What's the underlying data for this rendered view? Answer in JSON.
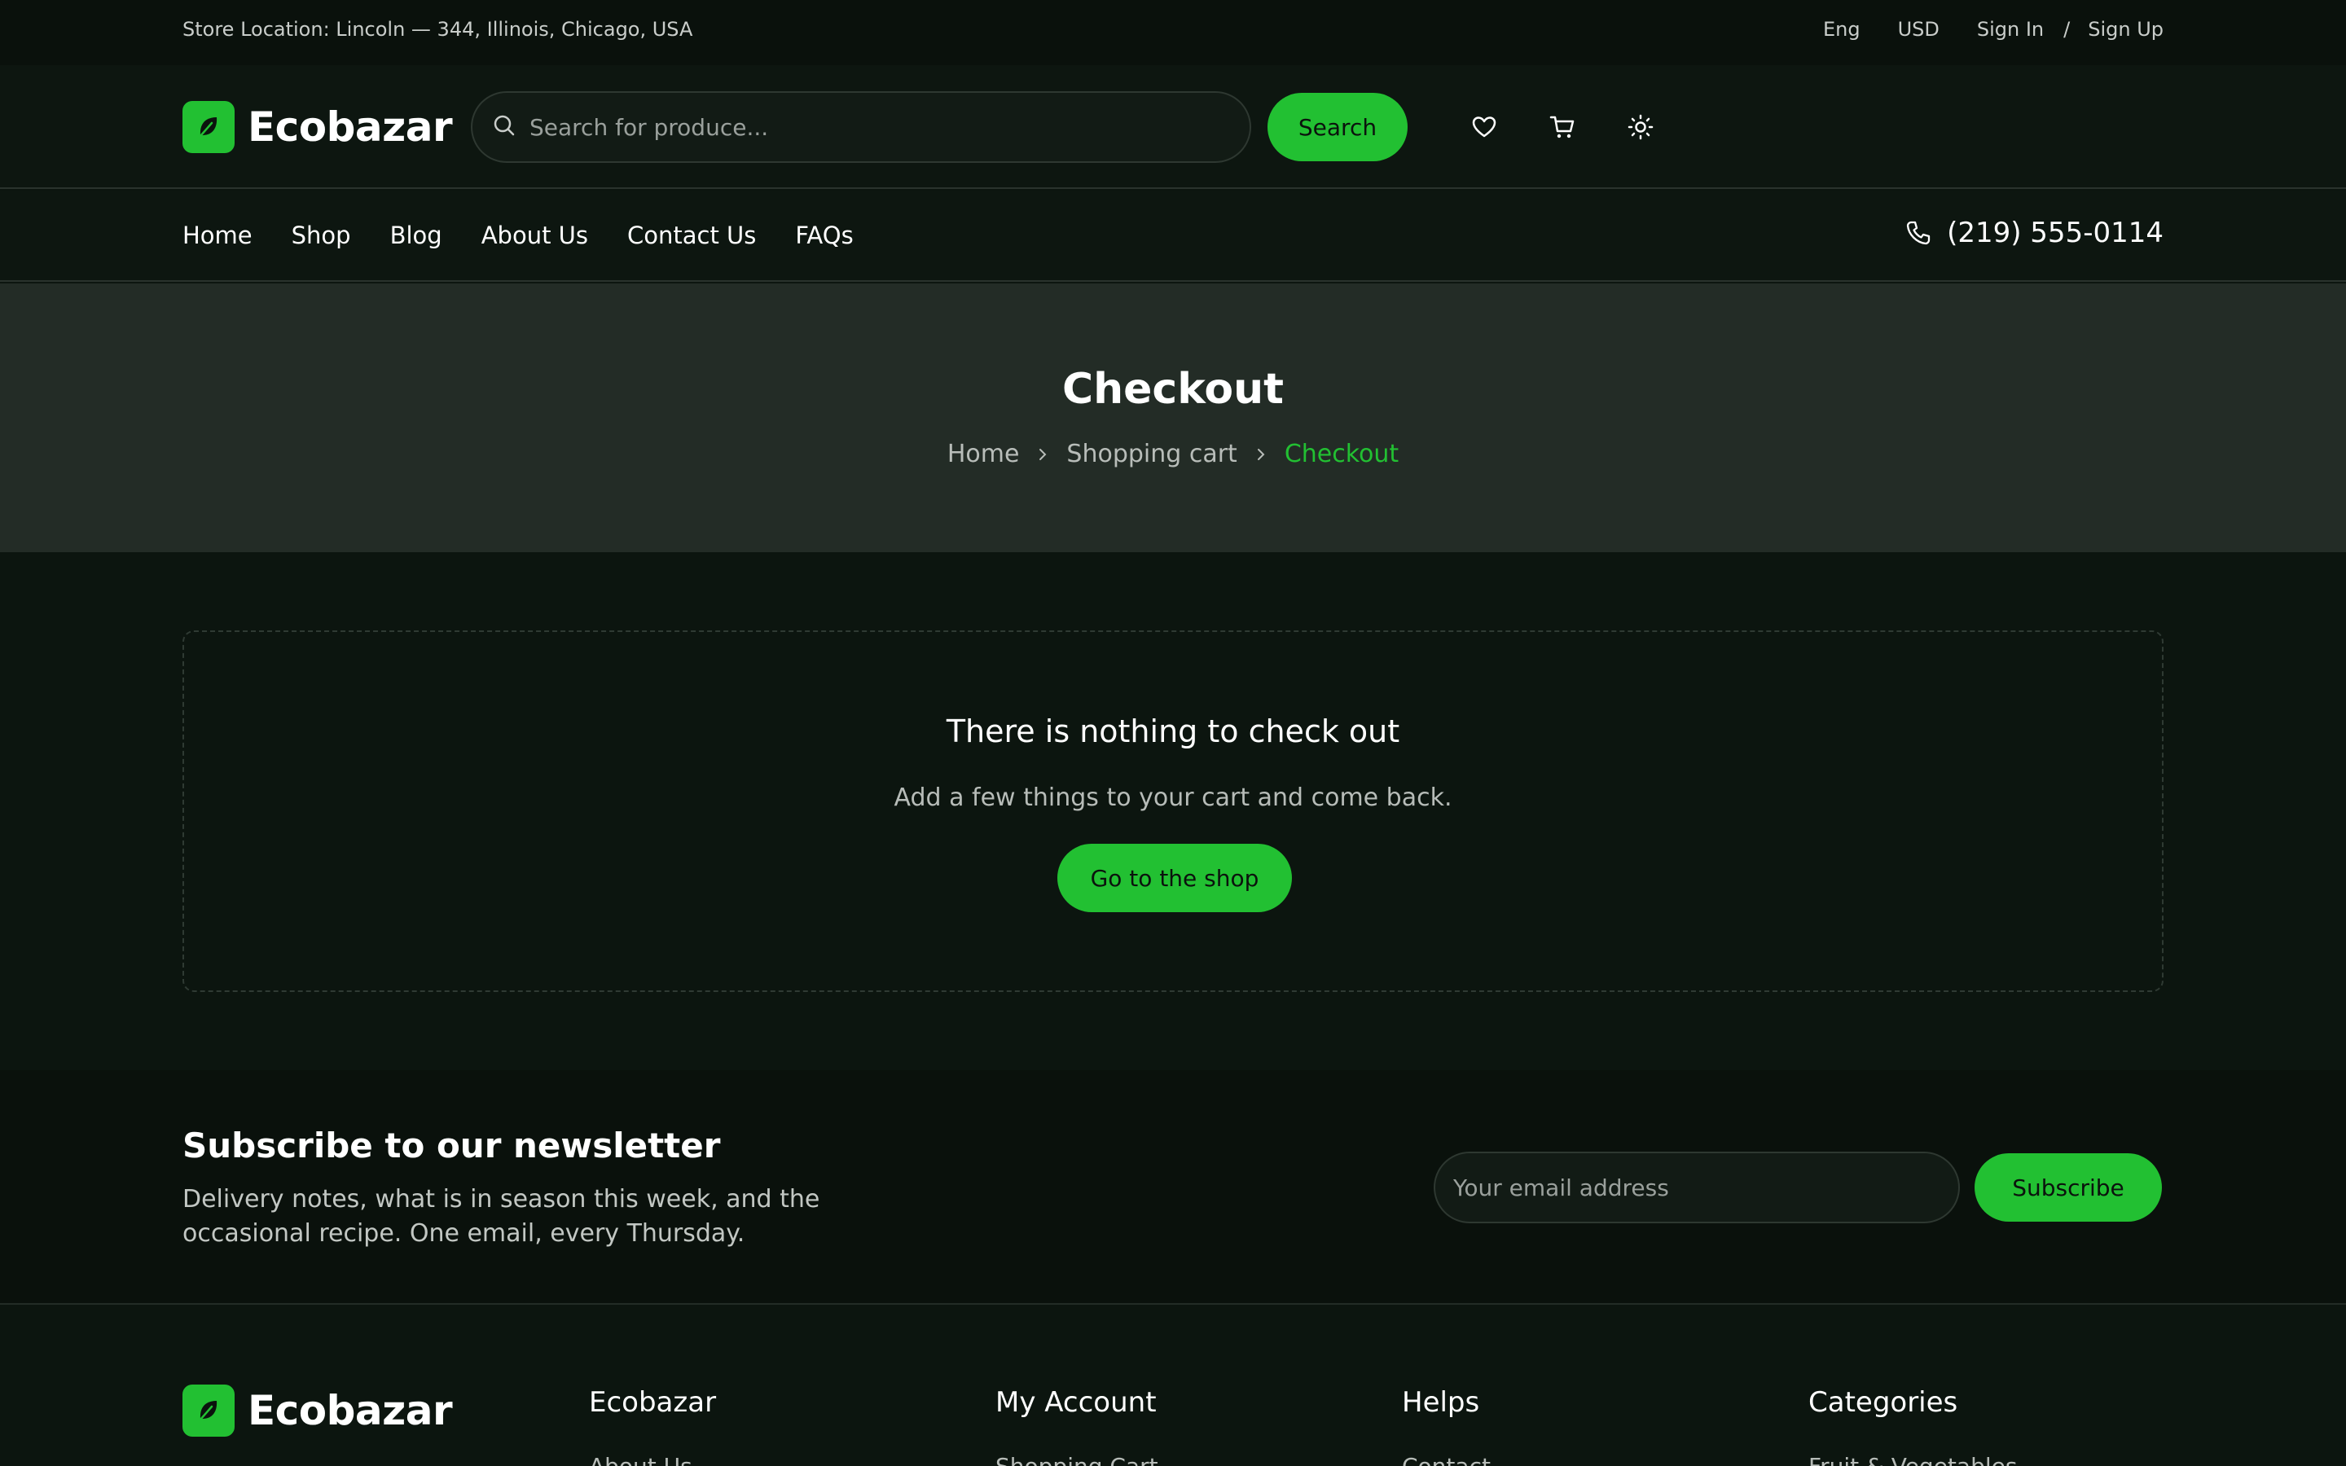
{
  "topbar": {
    "location": "Store Location: Lincoln — 344, Illinois, Chicago, USA",
    "language": "Eng",
    "currency": "USD",
    "sign_in": "Sign In",
    "separator": "/",
    "sign_up": "Sign Up"
  },
  "header": {
    "brand": "Ecobazar",
    "search_placeholder": "Search for produce...",
    "search_button": "Search"
  },
  "nav": {
    "items": [
      "Home",
      "Shop",
      "Blog",
      "About Us",
      "Contact Us",
      "FAQs"
    ],
    "phone": "(219) 555-0114"
  },
  "hero": {
    "title": "Checkout",
    "breadcrumb": [
      "Home",
      "Shopping cart",
      "Checkout"
    ]
  },
  "empty_state": {
    "heading": "There is nothing to check out",
    "message": "Add a few things to your cart and come back.",
    "button": "Go to the shop"
  },
  "newsletter": {
    "heading": "Subscribe to our newsletter",
    "description": "Delivery notes, what is in season this week, and the occasional recipe. One email, every Thursday.",
    "email_placeholder": "Your email address",
    "button": "Subscribe"
  },
  "footer": {
    "brand": "Ecobazar",
    "columns": [
      {
        "title": "Ecobazar",
        "first_link": "About Us"
      },
      {
        "title": "My Account",
        "first_link": "Shopping Cart"
      },
      {
        "title": "Helps",
        "first_link": "Contact"
      },
      {
        "title": "Categories",
        "first_link": "Fruit & Vegetables"
      }
    ]
  },
  "colors": {
    "accent": "#22c032",
    "background": "#0c150f",
    "hero_bg": "#232c26"
  },
  "icons": [
    "search-icon",
    "heart-icon",
    "cart-icon",
    "sun-icon",
    "phone-icon",
    "chevron-right-icon",
    "leaf-icon"
  ]
}
